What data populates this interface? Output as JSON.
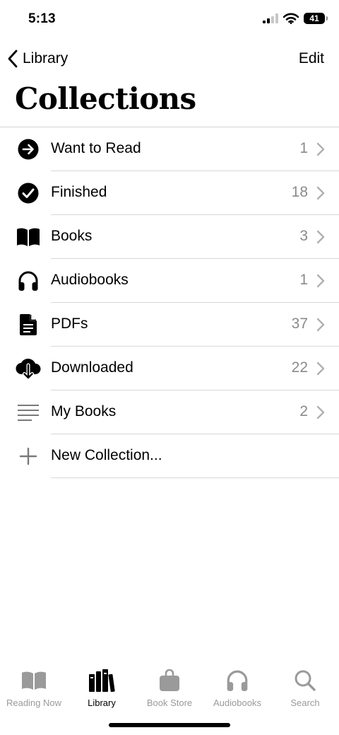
{
  "status_bar": {
    "time": "5:13",
    "battery_level": "41"
  },
  "nav": {
    "back_label": "Library",
    "edit_label": "Edit"
  },
  "page": {
    "title": "Collections"
  },
  "collections": [
    {
      "label": "Want to Read",
      "count": "1",
      "icon": "arrow-right-circle-icon"
    },
    {
      "label": "Finished",
      "count": "18",
      "icon": "checkmark-circle-icon"
    },
    {
      "label": "Books",
      "count": "3",
      "icon": "open-book-icon"
    },
    {
      "label": "Audiobooks",
      "count": "1",
      "icon": "headphones-icon"
    },
    {
      "label": "PDFs",
      "count": "37",
      "icon": "document-icon"
    },
    {
      "label": "Downloaded",
      "count": "22",
      "icon": "cloud-download-icon"
    },
    {
      "label": "My Books",
      "count": "2",
      "icon": "list-lines-icon"
    }
  ],
  "new_collection": {
    "label": "New Collection...",
    "icon": "plus-icon"
  },
  "tabs": [
    {
      "label": "Reading Now",
      "icon": "book-icon",
      "active": false
    },
    {
      "label": "Library",
      "icon": "library-books-icon",
      "active": true
    },
    {
      "label": "Book Store",
      "icon": "shopping-bag-icon",
      "active": false
    },
    {
      "label": "Audiobooks",
      "icon": "headphones-icon",
      "active": false
    },
    {
      "label": "Search",
      "icon": "magnifying-glass-icon",
      "active": false
    }
  ],
  "colors": {
    "text": "#000000",
    "secondary_text": "#8a8a8e",
    "divider": "#d8d8d8",
    "tab_inactive": "#9a9a9a"
  }
}
